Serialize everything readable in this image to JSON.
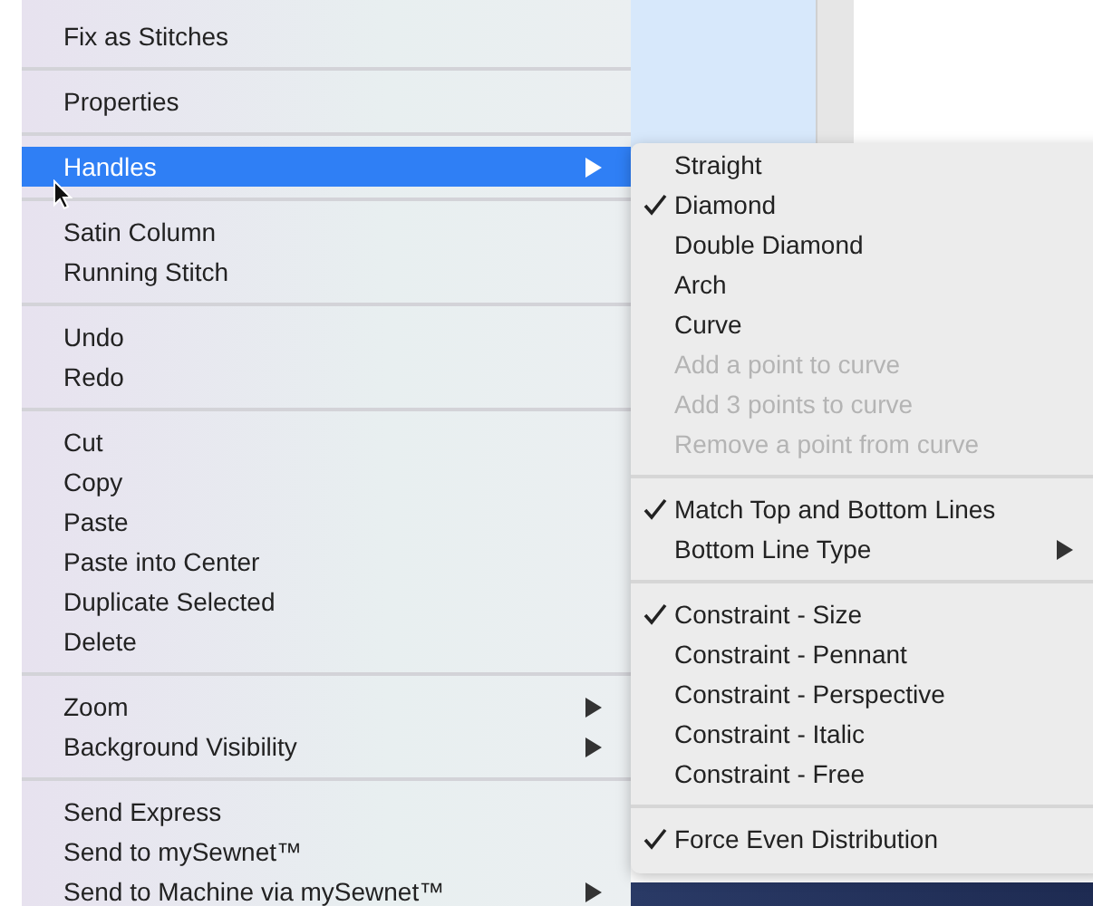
{
  "context_menu": {
    "groups": [
      [
        {
          "label": "Fix as Stitches",
          "selected": false,
          "has_submenu": false
        }
      ],
      [
        {
          "label": "Properties",
          "selected": false,
          "has_submenu": false
        }
      ],
      [
        {
          "label": "Handles",
          "selected": true,
          "has_submenu": true
        }
      ],
      [
        {
          "label": "Satin Column",
          "selected": false,
          "has_submenu": false
        },
        {
          "label": "Running Stitch",
          "selected": false,
          "has_submenu": false
        }
      ],
      [
        {
          "label": "Undo",
          "selected": false,
          "has_submenu": false
        },
        {
          "label": "Redo",
          "selected": false,
          "has_submenu": false
        }
      ],
      [
        {
          "label": "Cut",
          "selected": false,
          "has_submenu": false
        },
        {
          "label": "Copy",
          "selected": false,
          "has_submenu": false
        },
        {
          "label": "Paste",
          "selected": false,
          "has_submenu": false
        },
        {
          "label": "Paste into Center",
          "selected": false,
          "has_submenu": false
        },
        {
          "label": "Duplicate Selected",
          "selected": false,
          "has_submenu": false
        },
        {
          "label": "Delete",
          "selected": false,
          "has_submenu": false
        }
      ],
      [
        {
          "label": "Zoom",
          "selected": false,
          "has_submenu": true
        },
        {
          "label": "Background Visibility",
          "selected": false,
          "has_submenu": true
        }
      ],
      [
        {
          "label": "Send Express",
          "selected": false,
          "has_submenu": false
        },
        {
          "label": "Send to mySewnet™",
          "selected": false,
          "has_submenu": false
        },
        {
          "label": "Send to Machine via mySewnet™",
          "selected": false,
          "has_submenu": true
        }
      ]
    ]
  },
  "submenu": {
    "groups": [
      [
        {
          "label": "Straight",
          "checked": false,
          "disabled": false,
          "has_submenu": false
        },
        {
          "label": "Diamond",
          "checked": true,
          "disabled": false,
          "has_submenu": false
        },
        {
          "label": "Double Diamond",
          "checked": false,
          "disabled": false,
          "has_submenu": false
        },
        {
          "label": "Arch",
          "checked": false,
          "disabled": false,
          "has_submenu": false
        },
        {
          "label": "Curve",
          "checked": false,
          "disabled": false,
          "has_submenu": false
        },
        {
          "label": "Add a point to curve",
          "checked": false,
          "disabled": true,
          "has_submenu": false
        },
        {
          "label": "Add 3 points to curve",
          "checked": false,
          "disabled": true,
          "has_submenu": false
        },
        {
          "label": "Remove a point from curve",
          "checked": false,
          "disabled": true,
          "has_submenu": false
        }
      ],
      [
        {
          "label": "Match Top and Bottom Lines",
          "checked": true,
          "disabled": false,
          "has_submenu": false
        },
        {
          "label": "Bottom Line Type",
          "checked": false,
          "disabled": false,
          "has_submenu": true
        }
      ],
      [
        {
          "label": "Constraint - Size",
          "checked": true,
          "disabled": false,
          "has_submenu": false
        },
        {
          "label": "Constraint - Pennant",
          "checked": false,
          "disabled": false,
          "has_submenu": false
        },
        {
          "label": "Constraint - Perspective",
          "checked": false,
          "disabled": false,
          "has_submenu": false
        },
        {
          "label": "Constraint - Italic",
          "checked": false,
          "disabled": false,
          "has_submenu": false
        },
        {
          "label": "Constraint - Free",
          "checked": false,
          "disabled": false,
          "has_submenu": false
        }
      ],
      [
        {
          "label": "Force Even Distribution",
          "checked": true,
          "disabled": false,
          "has_submenu": false
        }
      ]
    ]
  }
}
